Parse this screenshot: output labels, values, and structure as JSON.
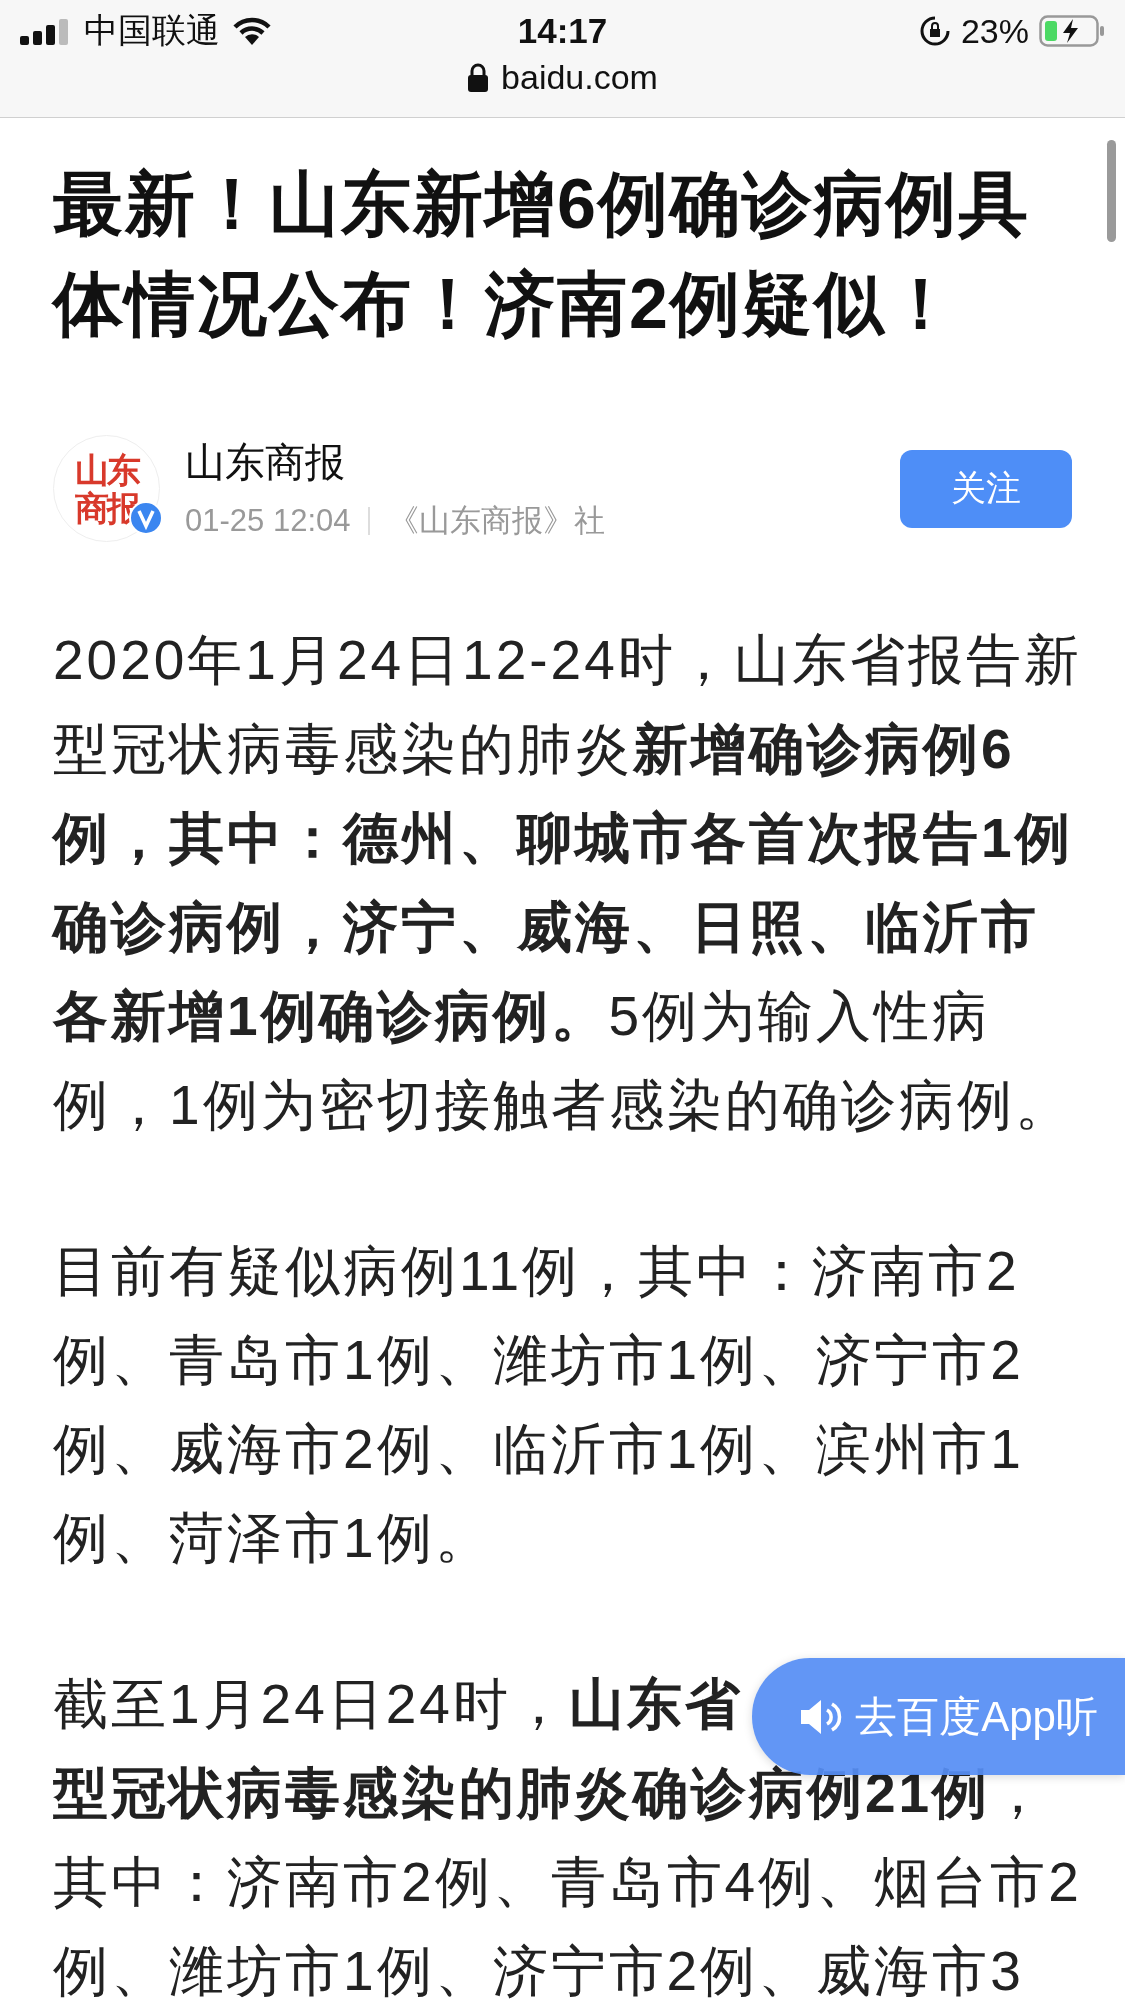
{
  "status_bar": {
    "carrier": "中国联通",
    "time": "14:17",
    "battery": "23%"
  },
  "address_bar": {
    "url": "baidu.com"
  },
  "article": {
    "title_lines": [
      "最新！山东新增6例确诊病例具",
      "体情况公布！济南2例疑似！"
    ],
    "author": {
      "logo_lines": [
        "山东",
        "商报"
      ],
      "name": "山东商报",
      "time": "01-25 12:04",
      "source": "《山东商报》社",
      "follow_button": "关注"
    },
    "paragraphs": [
      {
        "lines": [
          "2020年1月24日12-24时，山东省报告新",
          "型冠状病毒感染的肺炎**新增确诊病例6**",
          "**例，其中：德州、聊城市各首次报告1例**",
          "**确诊病例，济宁、威海、日照、临沂市**",
          "**各新增1例确诊病例。**5例为输入性病",
          "例，1例为密切接触者感染的确诊病例。"
        ]
      },
      {
        "lines": [
          "目前有疑似病例11例，其中：济南市2",
          "例、青岛市1例、潍坊市1例、济宁市2",
          "例、威海市2例、临沂市1例、滨州市1",
          "例、菏泽市1例。"
        ]
      },
      {
        "lines": [
          "截至1月24日24时，**山东省**",
          "**型冠状病毒感染的肺炎确诊病例21例**，",
          "其中：济南市2例、青岛市4例、烟台市2",
          "例、潍坊市1例、济宁市2例、威海市3"
        ]
      }
    ]
  },
  "listen_button": {
    "label": "去百度App听"
  }
}
